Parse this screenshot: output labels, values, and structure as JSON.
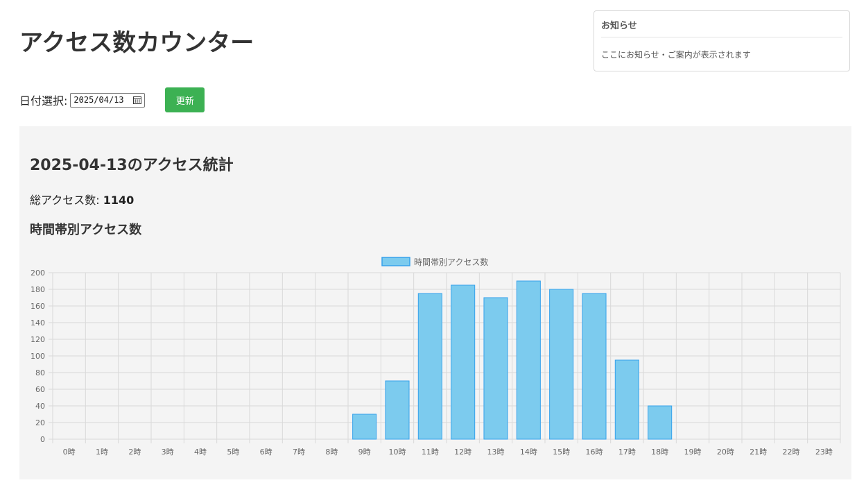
{
  "header": {
    "title": "アクセス数カウンター"
  },
  "notice": {
    "title": "お知らせ",
    "body": "ここにお知らせ・ご案内が表示されます"
  },
  "controls": {
    "date_label": "日付選択:",
    "date_value": "2025/04/13",
    "update_label": "更新"
  },
  "stats": {
    "heading": "2025-04-13のアクセス統計",
    "total_label": "総アクセス数:",
    "total_value": "1140",
    "hourly_heading": "時間帯別アクセス数"
  },
  "colors": {
    "bar_fill": "#7ccbee",
    "bar_stroke": "#36a2eb",
    "button": "#3cb153",
    "panel_bg": "#f4f4f4"
  },
  "chart_data": {
    "type": "bar",
    "categories": [
      "0時",
      "1時",
      "2時",
      "3時",
      "4時",
      "5時",
      "6時",
      "7時",
      "8時",
      "9時",
      "10時",
      "11時",
      "12時",
      "13時",
      "14時",
      "15時",
      "16時",
      "17時",
      "18時",
      "19時",
      "20時",
      "21時",
      "22時",
      "23時"
    ],
    "series": [
      {
        "name": "時間帯別アクセス数",
        "values": [
          0,
          0,
          0,
          0,
          0,
          0,
          0,
          0,
          0,
          30,
          70,
          175,
          185,
          170,
          190,
          180,
          175,
          95,
          40,
          0,
          0,
          0,
          0,
          0
        ]
      }
    ],
    "ylim": [
      0,
      200
    ],
    "yticks": [
      0,
      20,
      40,
      60,
      80,
      100,
      120,
      140,
      160,
      180,
      200
    ],
    "grid": true,
    "legend": "top-center"
  }
}
